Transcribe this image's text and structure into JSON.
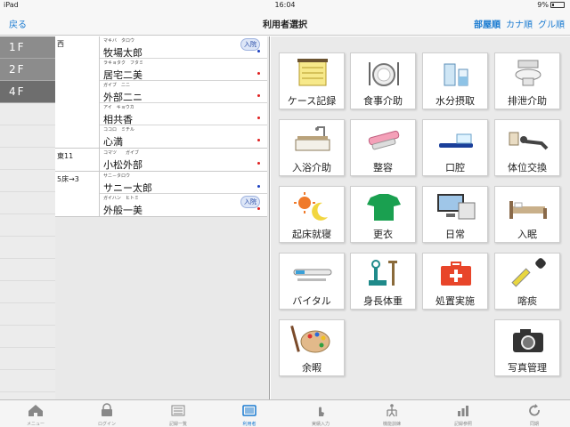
{
  "status": {
    "carrier": "iPad",
    "time": "16:04",
    "battery": "9%"
  },
  "nav": {
    "back": "戻る",
    "title": "利用者選択",
    "sorts": [
      "部屋順",
      "カナ順",
      "グル順"
    ]
  },
  "floors": [
    "1F",
    "2F",
    "4F"
  ],
  "groups": [
    {
      "room": "西",
      "people": [
        {
          "kana": "マキバ　タロウ",
          "name": "牧場太郎",
          "badge": "入院",
          "dot": "blue"
        },
        {
          "kana": "ラキョタク　フタミ",
          "name": "居宅二美",
          "dot": "red"
        },
        {
          "kana": "ガイブ　ニニ",
          "name": "外部二ニ",
          "dot": "red"
        },
        {
          "kana": "アイ　キョウカ",
          "name": "相共香",
          "dot": "red"
        },
        {
          "kana": "ココロ　ミチル",
          "name": "心満",
          "dot": "red"
        }
      ]
    },
    {
      "room": "東11",
      "people": [
        {
          "kana": "コマツ　　ガイブ",
          "name": "小松外部",
          "dot": "red"
        }
      ]
    },
    {
      "room": "5床→3",
      "people": [
        {
          "kana": "サニ－タロウ",
          "name": "サニー太郎",
          "dot": "blue"
        },
        {
          "kana": "ガイハン　ヒトミ",
          "name": "外般一美",
          "badge": "入院",
          "dot": "red"
        }
      ]
    }
  ],
  "tiles": [
    {
      "label": "ケース記録",
      "icon": "notepad-icon"
    },
    {
      "label": "食事介助",
      "icon": "meal-icon"
    },
    {
      "label": "水分摂取",
      "icon": "water-icon"
    },
    {
      "label": "排泄介助",
      "icon": "toilet-icon"
    },
    {
      "label": "入浴介助",
      "icon": "bath-icon"
    },
    {
      "label": "整容",
      "icon": "grooming-icon"
    },
    {
      "label": "口腔",
      "icon": "toothbrush-icon"
    },
    {
      "label": "体位交換",
      "icon": "position-change-icon"
    },
    {
      "label": "起床就寝",
      "icon": "sun-moon-icon"
    },
    {
      "label": "更衣",
      "icon": "shirt-icon"
    },
    {
      "label": "日常",
      "icon": "monitor-icon"
    },
    {
      "label": "入眠",
      "icon": "bed-icon"
    },
    {
      "label": "バイタル",
      "icon": "thermometer-icon"
    },
    {
      "label": "身長体重",
      "icon": "scale-icon"
    },
    {
      "label": "処置実施",
      "icon": "first-aid-icon"
    },
    {
      "label": "喀痰",
      "icon": "dropper-icon"
    },
    {
      "label": "余暇",
      "icon": "palette-icon"
    },
    {
      "label": "写真管理",
      "icon": "camera-icon"
    }
  ],
  "tabs": [
    {
      "label": "メニュー",
      "icon": "home-icon"
    },
    {
      "label": "ログイン",
      "icon": "lock-icon"
    },
    {
      "label": "記録一覧",
      "icon": "list-icon"
    },
    {
      "label": "利用者",
      "icon": "tablet-icon",
      "active": true
    },
    {
      "label": "実績入力",
      "icon": "hand-icon"
    },
    {
      "label": "機能訓練",
      "icon": "walker-icon"
    },
    {
      "label": "記録参照",
      "icon": "bar-chart-icon"
    },
    {
      "label": "同期",
      "icon": "sync-icon"
    }
  ],
  "colors": {
    "accent": "#1a7bd1",
    "dot_red": "#e02020",
    "dot_blue": "#1a3fc0"
  }
}
